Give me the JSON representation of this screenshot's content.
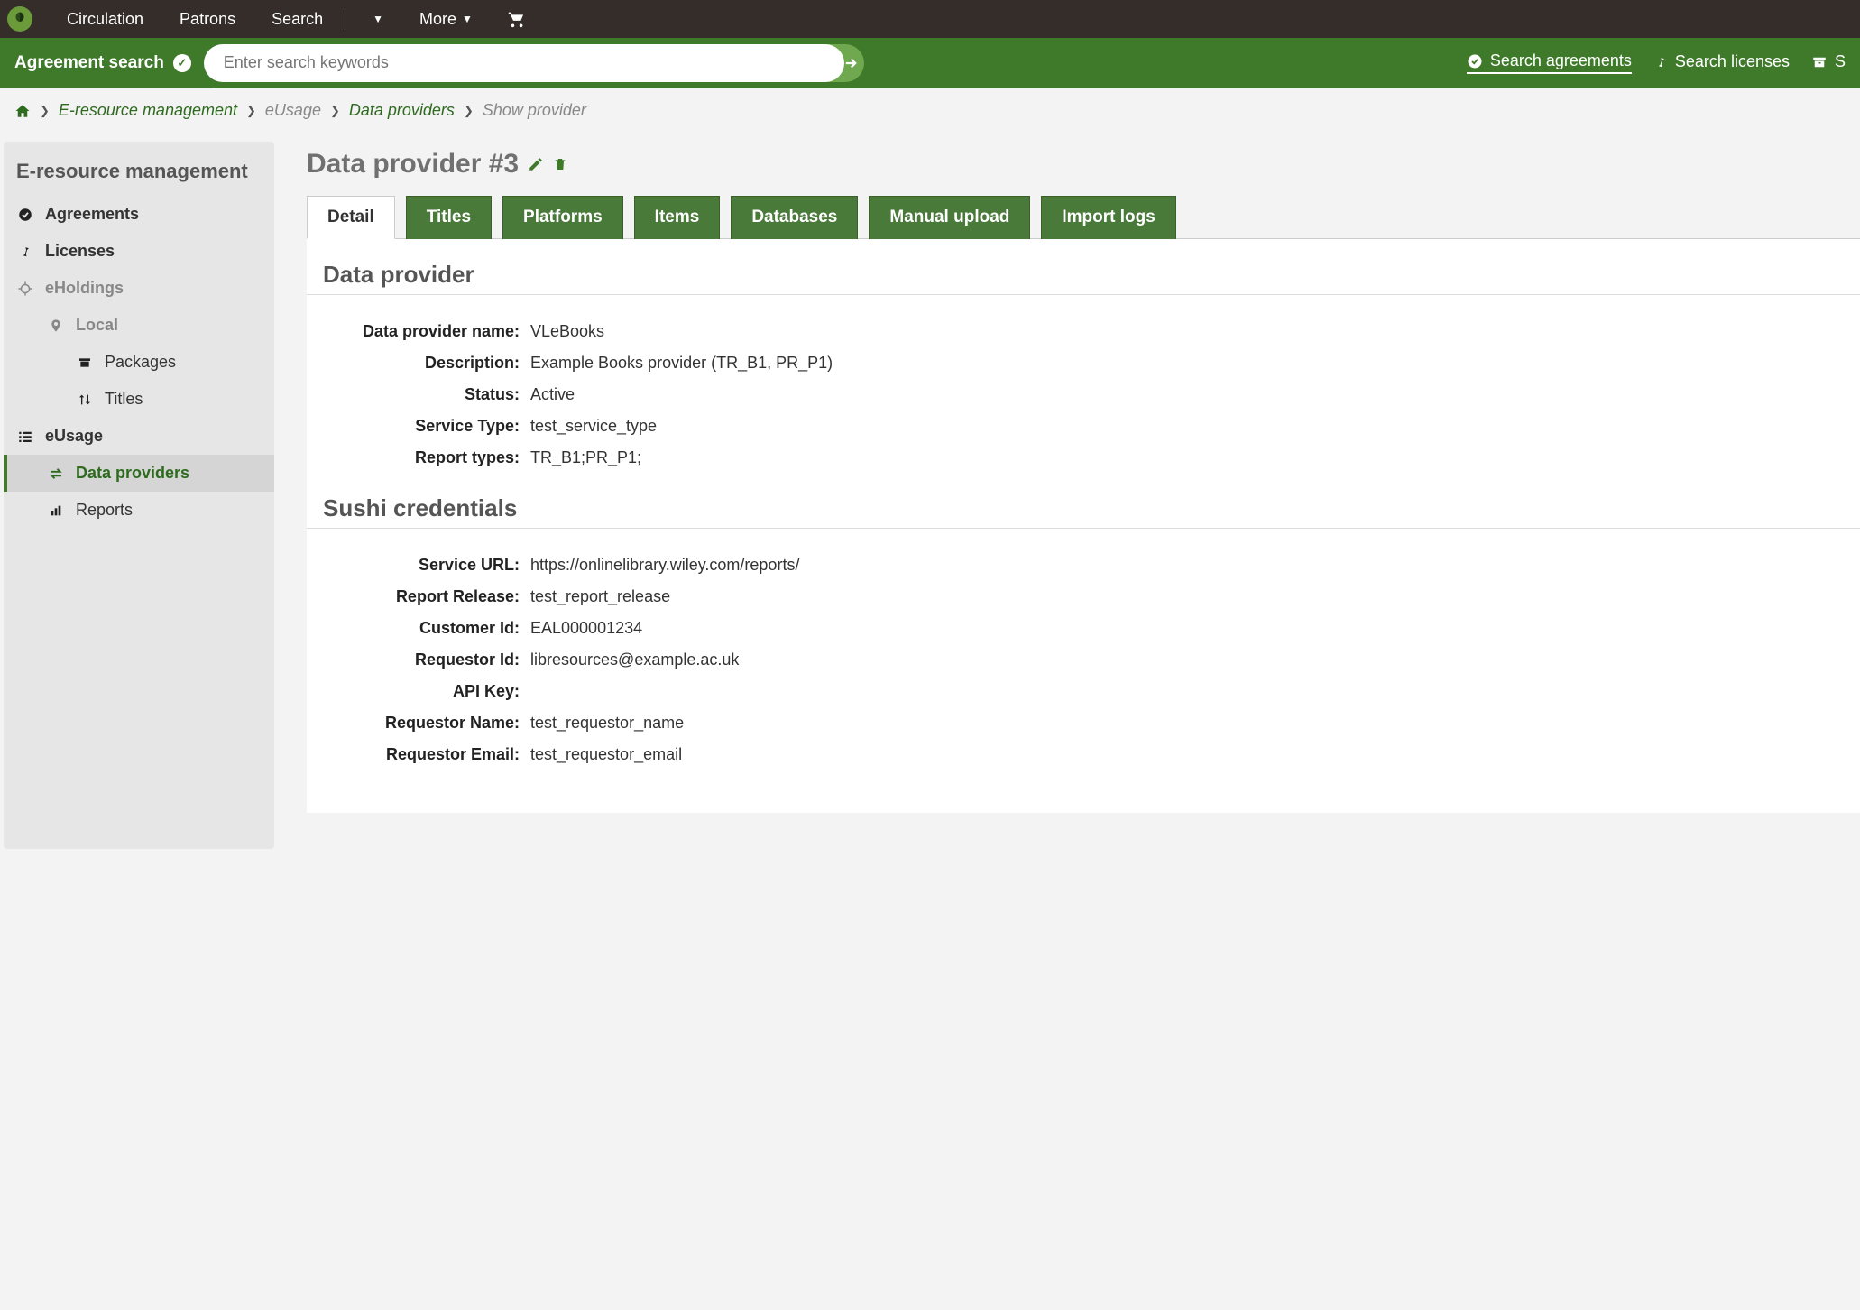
{
  "topnav": {
    "items": [
      "Circulation",
      "Patrons",
      "Search",
      "More"
    ]
  },
  "searchbar": {
    "label": "Agreement search",
    "placeholder": "Enter search keywords",
    "links": {
      "agreements": "Search agreements",
      "licenses": "Search licenses"
    }
  },
  "breadcrumb": {
    "items": [
      "E-resource management",
      "eUsage",
      "Data providers",
      "Show provider"
    ]
  },
  "sidebar": {
    "title": "E-resource management",
    "agreements": "Agreements",
    "licenses": "Licenses",
    "eholdings": "eHoldings",
    "local": "Local",
    "packages": "Packages",
    "titles": "Titles",
    "eusage": "eUsage",
    "dataproviders": "Data providers",
    "reports": "Reports"
  },
  "page": {
    "title": "Data provider #3"
  },
  "tabs": {
    "detail": "Detail",
    "titles": "Titles",
    "platforms": "Platforms",
    "items": "Items",
    "databases": "Databases",
    "manual": "Manual upload",
    "import": "Import logs"
  },
  "sections": {
    "provider": "Data provider",
    "sushi": "Sushi credentials"
  },
  "labels": {
    "name": "Data provider name:",
    "description": "Description:",
    "status": "Status:",
    "service_type": "Service Type:",
    "report_types": "Report types:",
    "service_url": "Service URL:",
    "report_release": "Report Release:",
    "customer_id": "Customer Id:",
    "requestor_id": "Requestor Id:",
    "api_key": "API Key:",
    "requestor_name": "Requestor Name:",
    "requestor_email": "Requestor Email:"
  },
  "values": {
    "name": "VLeBooks",
    "description": "Example Books provider (TR_B1, PR_P1)",
    "status": "Active",
    "service_type": "test_service_type",
    "report_types": "TR_B1;PR_P1;",
    "service_url": "https://onlinelibrary.wiley.com/reports/",
    "report_release": "test_report_release",
    "customer_id": "EAL000001234",
    "requestor_id": "libresources@example.ac.uk",
    "api_key": "",
    "requestor_name": "test_requestor_name",
    "requestor_email": "test_requestor_email"
  }
}
